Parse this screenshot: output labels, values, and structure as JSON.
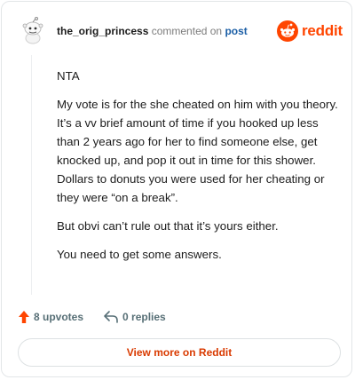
{
  "comment": {
    "username": "the_orig_princess",
    "action": "commented on",
    "post_link": "post",
    "paragraphs": [
      "NTA",
      "My vote is for the she cheated on him with you theory. It’s a vv brief amount of time if you hooked up less than 2 years ago for her to find someone else, get knocked up, and pop it out in time for this shower. Dollars to donuts you were used for her cheating or they were “on a break”.",
      "But obvi can’t rule out that it’s yours either.",
      "You need to get some answers."
    ]
  },
  "brand": {
    "logo_text": "reddit",
    "accent": "#ff4500"
  },
  "footer": {
    "upvotes_label": "8 upvotes",
    "replies_label": "0 replies",
    "upvote_icon": "upvote-arrow-icon",
    "reply_icon": "reply-arrow-icon"
  },
  "view_button": {
    "label": "View more on Reddit"
  }
}
